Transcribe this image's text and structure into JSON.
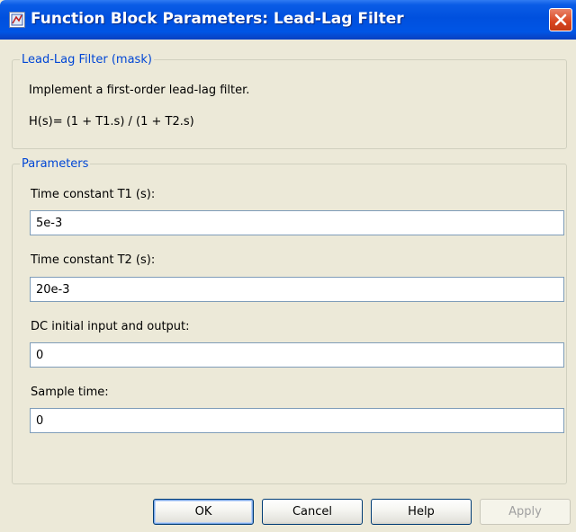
{
  "window": {
    "title": "Function Block Parameters: Lead-Lag Filter"
  },
  "mask": {
    "legend": "Lead-Lag Filter (mask)",
    "description": "Implement a first-order lead-lag filter.",
    "equation": "H(s)= (1 + T1.s) / (1 + T2.s)"
  },
  "parameters": {
    "legend": "Parameters",
    "fields": [
      {
        "label": "Time constant T1 (s):",
        "value": "5e-3"
      },
      {
        "label": "Time constant T2 (s):",
        "value": "20e-3"
      },
      {
        "label": "DC initial input and output:",
        "value": "0"
      },
      {
        "label": "Sample time:",
        "value": "0"
      }
    ]
  },
  "buttons": {
    "ok": "OK",
    "cancel": "Cancel",
    "help": "Help",
    "apply": "Apply"
  },
  "icons": {
    "app": "simulink-block-icon",
    "close": "close-icon"
  },
  "colors": {
    "titlebar": "#0054e3",
    "legend_text": "#0046d5",
    "dialog_bg": "#ece9d8",
    "close_button": "#d9451f"
  }
}
